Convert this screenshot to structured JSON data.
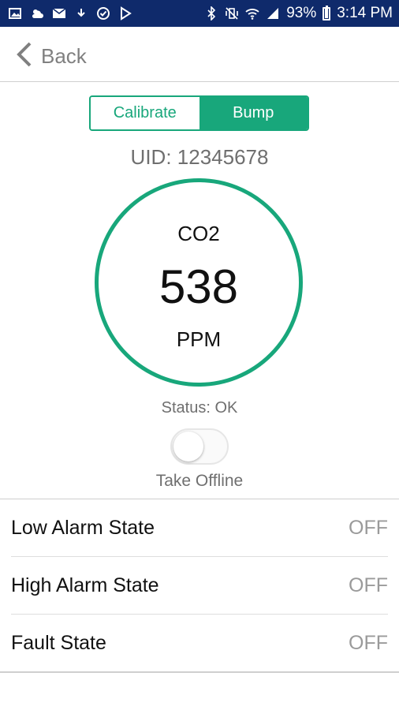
{
  "status_bar": {
    "battery": "93%",
    "time": "3:14 PM",
    "left_icons": [
      "image-icon",
      "weather-icon",
      "mail-icon",
      "download-icon",
      "check-circle-icon",
      "play-icon"
    ],
    "right_icons": [
      "bluetooth-icon",
      "mute-vibrate-icon",
      "wifi-icon",
      "signal-icon",
      "battery-icon"
    ],
    "bg_color": "#0f2a6b"
  },
  "header": {
    "back_label": "Back"
  },
  "mode_toggle": {
    "options": [
      "Calibrate",
      "Bump"
    ],
    "selected": "Bump",
    "accent_color": "#18a77b"
  },
  "uid_text": "UID: 12345678",
  "gauge": {
    "gas": "CO2",
    "value": "538",
    "unit": "PPM"
  },
  "status_text": "Status: OK",
  "offline_toggle": {
    "label": "Take Offline",
    "on": false
  },
  "states": [
    {
      "label": "Low Alarm State",
      "value": "OFF"
    },
    {
      "label": "High Alarm State",
      "value": "OFF"
    },
    {
      "label": "Fault State",
      "value": "OFF"
    }
  ]
}
